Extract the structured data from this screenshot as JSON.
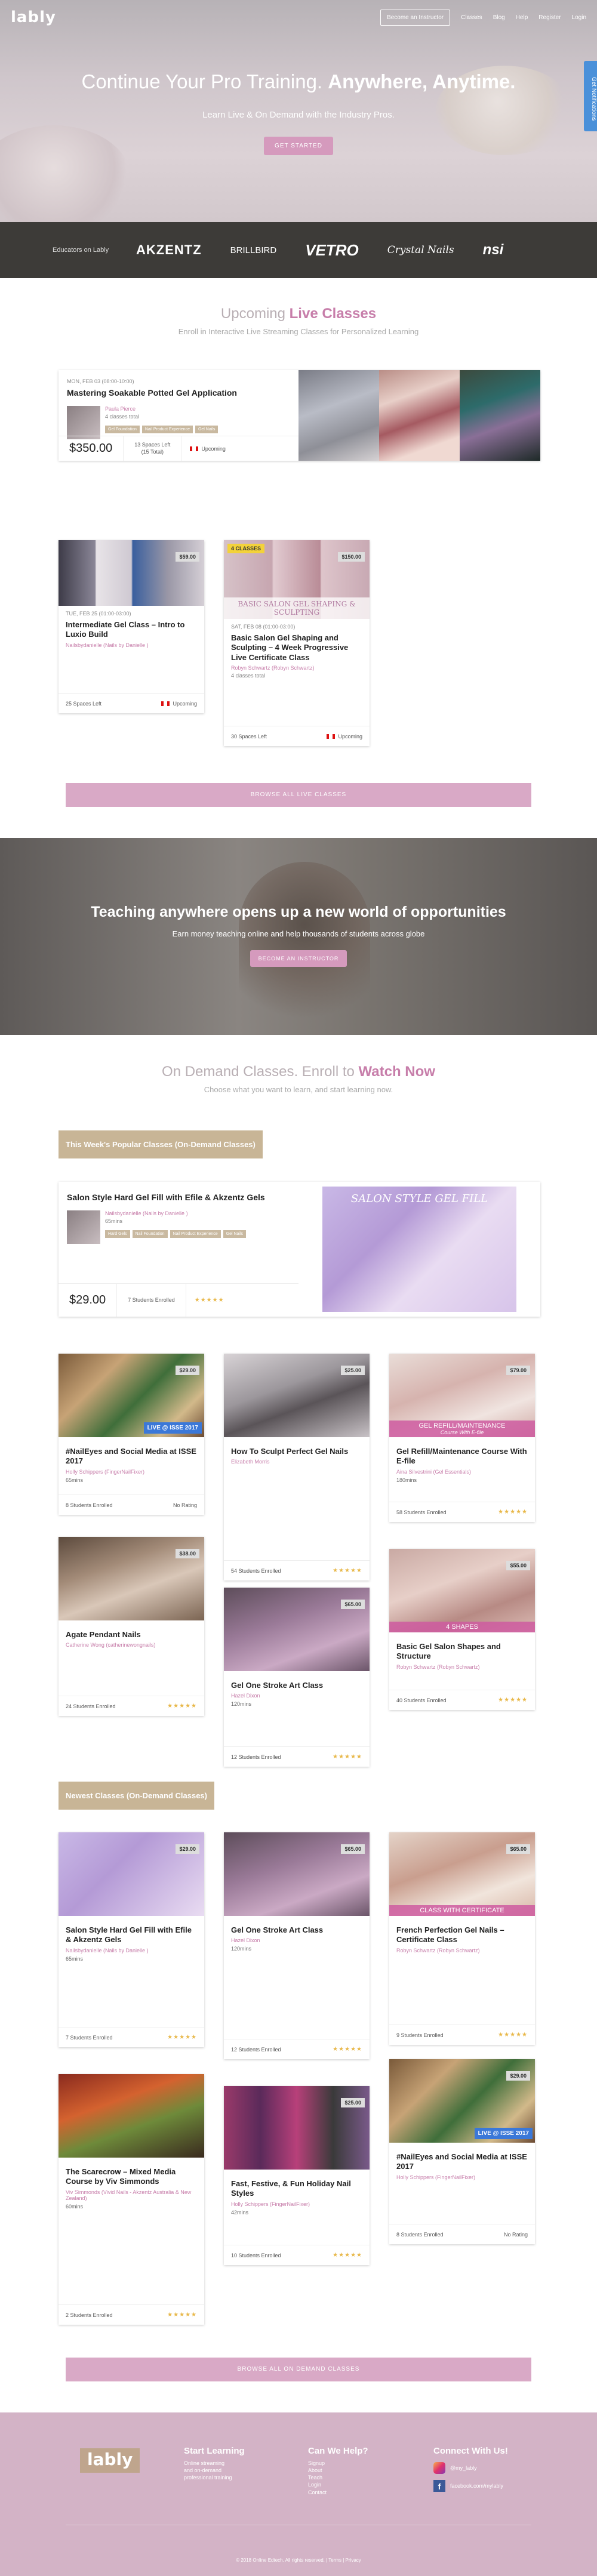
{
  "header": {
    "logo": "lably",
    "cta": "Become an Instructor",
    "links": [
      "Classes",
      "Blog",
      "Help",
      "Register",
      "Login"
    ],
    "notifications_tab": "Get Notifications"
  },
  "hero": {
    "title_plain": "Continue Your Pro Training.",
    "title_bold": "Anywhere, Anytime.",
    "subtitle": "Learn Live & On Demand with the Industry Pros.",
    "cta": "GET STARTED"
  },
  "educators": {
    "label": "Educators on Lably",
    "logos": [
      "AKZENTZ",
      "BRILLBIRD",
      "VETRO",
      "Crystal Nails",
      "nsi"
    ]
  },
  "live": {
    "title_plain": "Upcoming",
    "title_accent": "Live Classes",
    "subtitle": "Enroll in Interactive Live Streaming Classes for Personalized Learning",
    "featured": {
      "date": "MON, FEB 03 (08:00-10:00)",
      "title": "Mastering Soakable Potted Gel Application",
      "author": "Paula Pierce",
      "classes": "4 classes total",
      "tags": [
        "Gel Foundation",
        "Nail Product Experience",
        "Gel Nails"
      ],
      "price": "$350.00",
      "spaces": "13 Spaces Left",
      "total": "(15 Total)",
      "status": "Upcoming"
    },
    "cards": [
      {
        "price": "$59.00",
        "date": "TUE, FEB 25 (01:00-03:00)",
        "title": "Intermediate Gel Class – Intro to Luxio Build",
        "author": "Nailsbydanielle (Nails by Danielle )",
        "spaces": "25 Spaces Left",
        "status": "Upcoming"
      },
      {
        "price": "$150.00",
        "badge": "4 CLASSES",
        "overlay": "BASIC SALON GEL SHAPING & SCULPTING",
        "date": "SAT, FEB 08 (01:00-03:00)",
        "title": "Basic Salon Gel Shaping and Sculpting – 4 Week Progressive Live Certificate Class",
        "author": "Robyn Schwartz (Robyn Schwartz)",
        "classes": "4 classes total",
        "spaces": "30 Spaces Left",
        "status": "Upcoming"
      }
    ],
    "browse": "BROWSE ALL LIVE CLASSES"
  },
  "teach": {
    "title": "Teaching anywhere opens up a new world of opportunities",
    "subtitle": "Earn money teaching online and help thousands of students across globe",
    "cta": "BECOME AN INSTRUCTOR"
  },
  "ondemand": {
    "title_plain": "On Demand Classes. Enroll to",
    "title_accent": "Watch Now",
    "subtitle": "Choose what you want to learn, and start learning now.",
    "popular_label": "This Week's Popular Classes (On-Demand Classes)",
    "featured": {
      "title": "Salon Style Hard Gel Fill with Efile & Akzentz Gels",
      "author": "Nailsbydanielle (Nails by Danielle )",
      "mins": "65mins",
      "tags": [
        "Hard Gels",
        "Nail Foundation",
        "Nail Product Experience",
        "Gel Nails"
      ],
      "price": "$29.00",
      "students": "7 Students Enrolled",
      "overlay": "SALON STYLE GEL FILL",
      "stars": "★★★★★"
    },
    "popular": [
      {
        "title": "#NailEyes and Social Media at ISSE 2017",
        "author": "Holly Schippers (FingerNailFixer)",
        "mins": "65mins",
        "price": "$29.00",
        "students": "8 Students Enrolled",
        "rating": "No Rating",
        "live": "LIVE @ ISSE 2017"
      },
      {
        "title": "How To Sculpt Perfect Gel Nails",
        "author": "Elizabeth Morris",
        "mins": "",
        "price": "$25.00",
        "students": "54 Students Enrolled",
        "rating": "★★★★★"
      },
      {
        "title": "Gel Refill/Maintenance Course With E-file",
        "author": "Aina Silvestrini (Gel Essentials)",
        "mins": "180mins",
        "price": "$79.00",
        "students": "58 Students Enrolled",
        "rating": "★★★★★",
        "overlay": "GEL REFILL/MAINTENANCE",
        "overlay_sub": "Course With E-file"
      },
      {
        "title": "Agate Pendant Nails",
        "author": "Catherine Wong (catherinewongnails)",
        "mins": "",
        "price": "$38.00",
        "students": "24 Students Enrolled",
        "rating": "★★★★★"
      },
      {
        "title": "Gel One Stroke Art Class",
        "author": "Hazel Dixon",
        "mins": "120mins",
        "price": "$65.00",
        "students": "12 Students Enrolled",
        "rating": "★★★★★"
      },
      {
        "title": "Basic Gel Salon Shapes and Structure",
        "author": "Robyn Schwartz (Robyn Schwartz)",
        "mins": "",
        "price": "$55.00",
        "students": "40 Students Enrolled",
        "rating": "★★★★★",
        "overlay": "4 SHAPES"
      }
    ],
    "newest_label": "Newest Classes (On-Demand Classes)",
    "newest": [
      {
        "title": "Salon Style Hard Gel Fill with Efile & Akzentz Gels",
        "author": "Nailsbydanielle (Nails by Danielle )",
        "mins": "65mins",
        "price": "$29.00",
        "students": "7 Students Enrolled",
        "rating": "★★★★★"
      },
      {
        "title": "Gel One Stroke Art Class",
        "author": "Hazel Dixon",
        "mins": "120mins",
        "price": "$65.00",
        "students": "12 Students Enrolled",
        "rating": "★★★★★"
      },
      {
        "title": "French Perfection Gel Nails – Certificate Class",
        "author": "Robyn Schwartz (Robyn Schwartz)",
        "mins": "",
        "price": "$65.00",
        "students": "9 Students Enrolled",
        "rating": "★★★★★",
        "overlay": "CLASS WITH CERTIFICATE"
      },
      {
        "title": "The Scarecrow – Mixed Media Course by Viv Simmonds",
        "author": "Viv Simmonds (Vivid Nails - Akzentz Australia & New Zealand)",
        "mins": "60mins",
        "price": "",
        "students": "2 Students Enrolled",
        "rating": "★★★★★"
      },
      {
        "title": "Fast, Festive, & Fun Holiday Nail Styles",
        "author": "Holly Schippers (FingerNailFixer)",
        "mins": "42mins",
        "price": "$25.00",
        "students": "10 Students Enrolled",
        "rating": "★★★★★"
      },
      {
        "title": "#NailEyes and Social Media at ISSE 2017",
        "author": "Holly Schippers (FingerNailFixer)",
        "mins": "",
        "price": "$29.00",
        "students": "8 Students Enrolled",
        "rating": "No Rating",
        "live": "LIVE @ ISSE 2017"
      }
    ],
    "browse": "BROWSE ALL ON DEMAND CLASSES"
  },
  "footer": {
    "logo": "lably",
    "col1_title": "Start Learning",
    "col1_text": [
      "Online streaming",
      "and on-demand",
      "professional training"
    ],
    "col2_title": "Can We Help?",
    "col2_links": [
      "Signup",
      "About",
      "Teach",
      "Login",
      "Contact"
    ],
    "col3_title": "Connect With Us!",
    "instagram": "@my_lably",
    "facebook": "facebook.com/mylably",
    "copyright": "© 2018 Online Edtech. All rights reserved. | Terms | Privacy"
  },
  "colors": {
    "accent_pink": "#c77eaa",
    "button_pink": "#d59abd",
    "beige": "#c8b596",
    "footer": "#d3b3c6",
    "dark_band": "#3d3b38"
  }
}
